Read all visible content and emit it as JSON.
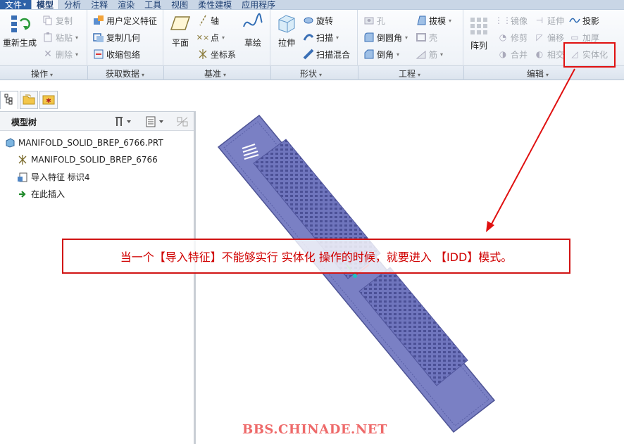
{
  "menu": {
    "file": "文件",
    "tabs": [
      "模型",
      "分析",
      "注释",
      "渲染",
      "工具",
      "视图",
      "柔性建模",
      "应用程序"
    ]
  },
  "ribbon": {
    "operations": {
      "regenerate": "重新生成",
      "copy": "复制",
      "paste": "粘贴",
      "delete": "删除",
      "group_label": "操作"
    },
    "get_data": {
      "udf": "用户定义特征",
      "copy_geom": "复制几何",
      "shrinkwrap": "收缩包络",
      "group_label": "获取数据"
    },
    "datum": {
      "plane": "平面",
      "axis": "轴",
      "point": "点",
      "csys": "坐标系",
      "sketch": "草绘",
      "group_label": "基准"
    },
    "shapes": {
      "extrude": "拉伸",
      "revolve": "旋转",
      "sweep": "扫描",
      "swept_blend": "扫描混合",
      "group_label": "形状"
    },
    "engineering": {
      "hole": "孔",
      "draft": "拔模",
      "round": "倒圆角",
      "shell": "壳",
      "chamfer": "倒角",
      "rib": "筋",
      "group_label": "工程"
    },
    "editing": {
      "pattern": "阵列",
      "mirror": "镜像",
      "extend": "延伸",
      "project": "投影",
      "trim": "修剪",
      "offset": "偏移",
      "thicken": "加厚",
      "merge": "合并",
      "intersect": "相交",
      "solidify": "实体化",
      "group_label": "编辑"
    }
  },
  "model_tree": {
    "title": "模型树",
    "nodes": [
      "MANIFOLD_SOLID_BREP_6766.PRT",
      "MANIFOLD_SOLID_BREP_6766",
      "导入特征 标识4",
      "在此插入"
    ]
  },
  "callout": {
    "text": "当一个【导入特征】不能够实行 实体化 操作的时候，就要进入 【IDD】模式。",
    "color": "#d00000"
  },
  "watermark": "BBS.CHINADE.NET",
  "colors": {
    "menu_bar": "#c9d6e6",
    "file_tab": "#2e62a8",
    "part_fill": "#7a80c4",
    "part_edge": "#4e5496",
    "annotation": "#e01010"
  }
}
